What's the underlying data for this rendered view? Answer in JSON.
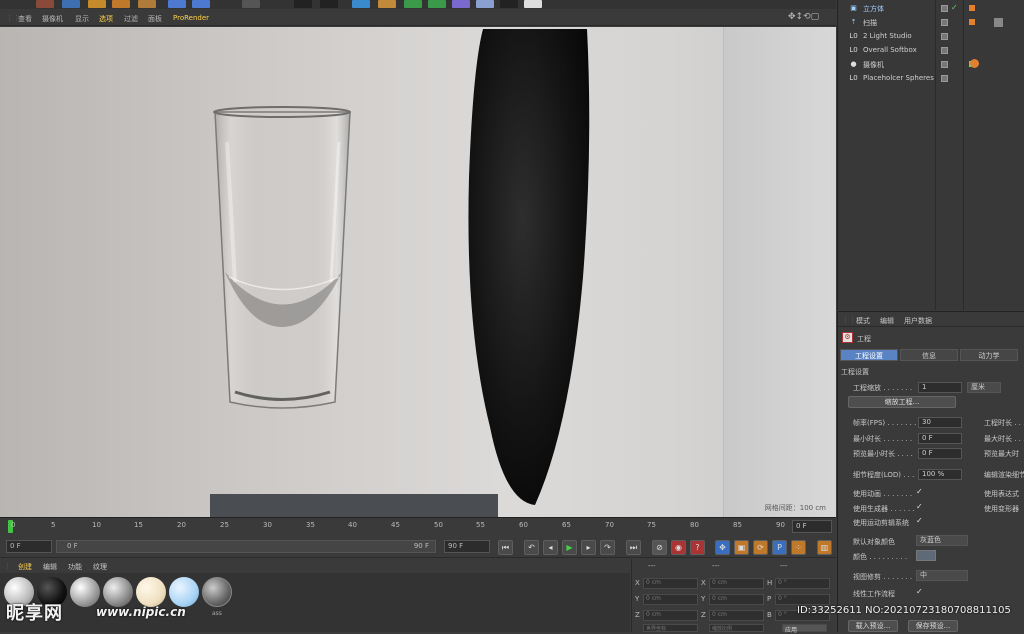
{
  "viewport": {
    "menu": [
      "查看",
      "摄像机",
      "显示",
      "选项",
      "过滤",
      "面板",
      "ProRender"
    ],
    "active_menu": "选项",
    "nav_icons": "✥↕⟲▢",
    "grid_label": "网格间距：100 cm"
  },
  "timeline": {
    "ticks": [
      "0",
      "5",
      "10",
      "15",
      "20",
      "25",
      "30",
      "35",
      "40",
      "45",
      "50",
      "55",
      "60",
      "65",
      "70",
      "75",
      "80",
      "85",
      "90"
    ],
    "current_frame_box": "0 F"
  },
  "transport": {
    "start": "0 F",
    "min_field": "0 F",
    "max_field": "90 F",
    "end": "90 F"
  },
  "material_manager": {
    "menu": [
      "创建",
      "编辑",
      "功能",
      "纹理"
    ],
    "swatch_label_last": "ass"
  },
  "coordinates": {
    "rows": [
      {
        "a": "X",
        "av": "0 cm",
        "b": "X",
        "bv": "0 cm",
        "c": "H",
        "cv": "0 °"
      },
      {
        "a": "Y",
        "av": "0 cm",
        "b": "Y",
        "bv": "0 cm",
        "c": "P",
        "cv": "0 °"
      },
      {
        "a": "Z",
        "av": "0 cm",
        "b": "Z",
        "bv": "0 cm",
        "c": "B",
        "cv": "0 °"
      }
    ],
    "header": "---",
    "apply_label": "应用",
    "bottom_left": "世界坐标",
    "bottom_mid": "缩放比例"
  },
  "objects": [
    {
      "name": "立方体",
      "icon": "▣",
      "highlight": true
    },
    {
      "name": "扫描",
      "icon": "⤒"
    },
    {
      "name": "2 Light Studio",
      "icon": "L0"
    },
    {
      "name": "Overall Softbox",
      "icon": "L0"
    },
    {
      "name": "摄像机",
      "icon": "●"
    },
    {
      "name": "Placeholcer Spheres",
      "icon": "L0"
    }
  ],
  "attributes": {
    "menu": [
      "模式",
      "编辑",
      "用户数据"
    ],
    "title": "工程",
    "tabs": [
      "工程设置",
      "信息",
      "动力学"
    ],
    "section": "工程设置",
    "scale_label": "工程缩放 . . . . . . .",
    "scale_value": "1",
    "scale_unit": "厘米",
    "scale_btn": "缩放工程...",
    "fps_label": "帧率(FPS) . . . . . . .",
    "fps_value": "30",
    "project_length_label": "工程时长 . . .",
    "min_label": "最小时长 . . . . . . .",
    "min_value": "0 F",
    "max_label": "最大时长 . . .",
    "preview_min_label": "预览最小时长 . . . .",
    "preview_min_value": "0 F",
    "preview_max_label": "预览最大时",
    "lod_label": "细节程度(LOD) . . .",
    "lod_value": "100 %",
    "lod_right_label": "编辑渲染细节",
    "use_anim_label": "使用动画 . . . . . . .",
    "use_expr_label": "使用表达式",
    "use_gen_label": "使用生成器 . . . . . .",
    "use_deform_label": "使用变形器",
    "use_motion_label": "使用运动剪辑系统",
    "default_color_label": "默认对象颜色",
    "default_color_value": "灰蓝色",
    "color_label": "颜色 . . . . . . . . .",
    "view_clip_label": "视图修剪 . . . . . . .",
    "view_clip_value": "中",
    "linear_label": "线性工作流程",
    "load_preset": "载入预设...",
    "save_preset": "保存预设..."
  },
  "watermark": {
    "logo": "昵享网",
    "url": "www.nipic.cn",
    "id": "ID:33252611 NO:20210723180708811105"
  }
}
